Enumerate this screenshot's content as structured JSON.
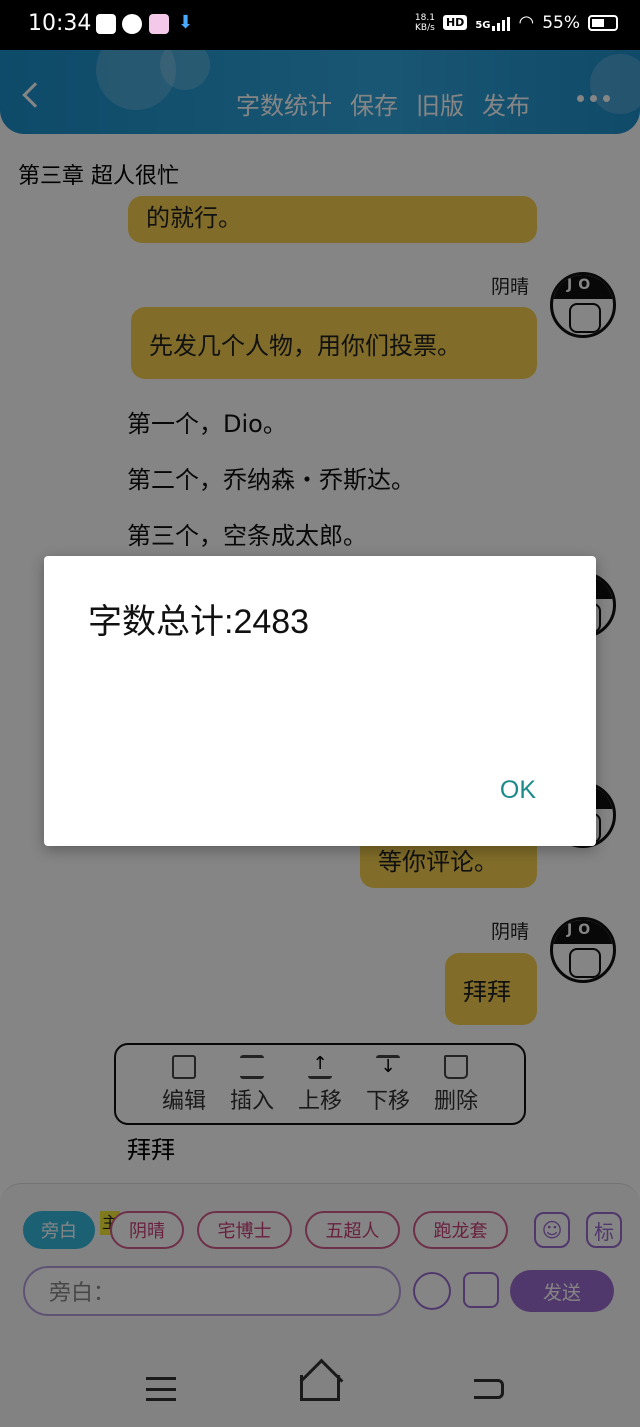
{
  "status_bar": {
    "time": "10:34",
    "net_speed_value": "18.1",
    "net_speed_unit": "KB/s",
    "hd_badge": "HD",
    "network_type": "5G",
    "battery": "55%"
  },
  "header": {
    "actions": [
      "字数统计",
      "保存",
      "旧版",
      "发布"
    ]
  },
  "chapter_title": "第三章  超人很忙",
  "messages": [
    {
      "text": "的就行。"
    },
    {
      "speaker": "阴晴",
      "avatar_text": "JO",
      "text": "先发几个人物，用你们投票。"
    },
    {
      "speaker": "阴晴",
      "avatar_text": "JO",
      "text": "等你评论。"
    },
    {
      "speaker": "阴晴",
      "avatar_text": "JO",
      "text": "拜拜"
    }
  ],
  "narration": [
    "第一个，Dio。",
    "第二个，乔纳森・乔斯达。",
    "第三个，空条成太郎。"
  ],
  "edit_toolbar": {
    "items": [
      {
        "label": "编辑",
        "icon": "edit-icon"
      },
      {
        "label": "插入",
        "icon": "insert-icon"
      },
      {
        "label": "上移",
        "icon": "move-up-icon"
      },
      {
        "label": "下移",
        "icon": "move-down-icon"
      },
      {
        "label": "删除",
        "icon": "delete-icon"
      }
    ]
  },
  "selected_text": "拜拜",
  "roles": {
    "active": "旁白",
    "main_badge": "主",
    "chips": [
      "阴晴",
      "宅博士",
      "五超人",
      "跑龙套"
    ],
    "person_icon_label": "",
    "tag_icon_label": "标"
  },
  "input": {
    "placeholder": "旁白：",
    "send_label": "发送"
  },
  "dialog": {
    "message": "字数总计:2483",
    "ok_label": "OK"
  }
}
